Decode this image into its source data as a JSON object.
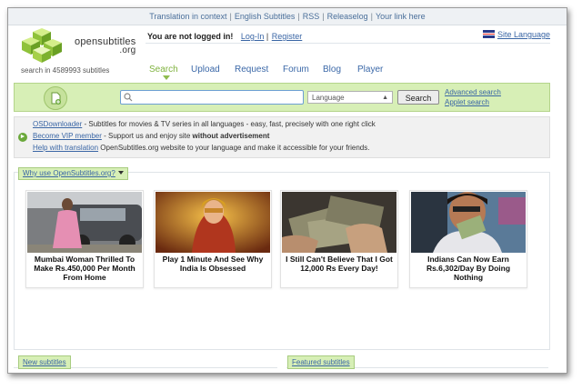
{
  "topnav": {
    "links": [
      "Translation in context",
      "English Subtitles",
      "RSS",
      "Releaselog",
      "Your link here"
    ]
  },
  "brand": {
    "name": "opensubtitles",
    "tld": ".org",
    "search_count": "search in 4589993 subtitles"
  },
  "header": {
    "login_status": "You are not logged in!",
    "login_link": "Log-In",
    "login_sep": "|",
    "register_link": "Register",
    "site_language": "Site Language"
  },
  "nav": {
    "items": [
      "Search",
      "Upload",
      "Request",
      "Forum",
      "Blog",
      "Player"
    ],
    "active": "Search"
  },
  "search": {
    "query": "",
    "placeholder": "",
    "language_value": "Language",
    "button": "Search",
    "advanced_link": "Advanced search",
    "applet_link": "Applet search"
  },
  "info": {
    "line1_link": "OSDownloader",
    "line1_text": " - Subtitles for movies & TV series in all languages - easy, fast, precisely with one right click",
    "line2_link": "Become VIP member",
    "line2_text": " - Support us and enjoy site ",
    "line2_bold": "without advertisement",
    "line3_link": "Help with translation",
    "line3_text": " OpenSubtitles.org website to your language and make it accessible for your friends."
  },
  "why": {
    "label": "Why use OpenSubtitles.org?"
  },
  "ads": [
    {
      "caption": "Mumbai Woman Thrilled To Make Rs.450,000 Per Month From Home"
    },
    {
      "caption": "Play 1 Minute And See Why India Is Obsessed"
    },
    {
      "caption": "I Still Can't Believe That I Got 12,000 Rs Every Day!"
    },
    {
      "caption": "Indians Can Now Earn Rs.6,302/Day By Doing Nothing"
    }
  ],
  "sections": {
    "new_subtitles": "New subtitles",
    "featured_subtitles": "Featured subtitles"
  },
  "colors": {
    "accent_green": "#d7efb6",
    "link_blue": "#3a66a5",
    "active_green": "#7fb23e"
  }
}
